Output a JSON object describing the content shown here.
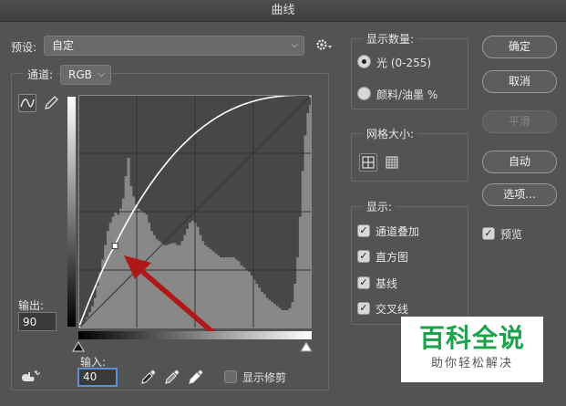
{
  "window": {
    "title": "曲线"
  },
  "preset": {
    "label": "预设:",
    "value": "自定"
  },
  "channel": {
    "label": "通道:",
    "value": "RGB"
  },
  "curve": {
    "points": [
      [
        0,
        0
      ],
      [
        40,
        90
      ],
      [
        255,
        255
      ]
    ],
    "histogram": [
      2,
      4,
      7,
      11,
      16,
      22,
      30,
      42,
      55,
      68,
      82,
      96,
      104,
      110,
      114,
      112,
      118,
      128,
      150,
      168,
      140,
      130,
      122,
      118,
      116,
      114,
      112,
      104,
      96,
      92,
      88,
      86,
      84,
      82,
      82,
      83,
      84,
      84,
      82,
      82,
      86,
      92,
      98,
      104,
      106,
      104,
      100,
      92,
      86,
      82,
      80,
      78,
      76,
      74,
      72,
      70,
      70,
      70,
      70,
      70,
      70,
      68,
      66,
      62,
      60,
      58,
      56,
      52,
      48,
      44,
      40,
      36,
      34,
      30,
      28,
      26,
      24,
      22,
      20,
      18,
      18,
      18,
      20,
      26,
      44,
      70,
      110,
      155,
      190,
      212,
      220
    ],
    "histogram_color": "#888888",
    "curve_color": "#ffffff"
  },
  "output": {
    "label": "输出:",
    "value": "90"
  },
  "input": {
    "label": "输入:",
    "value": "40"
  },
  "show_amount": {
    "title": "显示数量:",
    "light": "光 (0-255)",
    "pigment": "颜料/油墨 %",
    "selected": "light"
  },
  "grid_size": {
    "title": "网格大小:"
  },
  "show": {
    "title": "显示:",
    "channel_overlay": "通道叠加",
    "histogram": "直方图",
    "baseline": "基线",
    "intersection": "交叉线"
  },
  "buttons": {
    "ok": "确定",
    "cancel": "取消",
    "smooth": "平滑",
    "auto": "自动",
    "options": "选项..."
  },
  "preview": {
    "label": "预览",
    "checked": true
  },
  "show_clipping": {
    "label": "显示修剪",
    "checked": false
  },
  "annotation": {
    "arrow_color": "#b01818"
  },
  "watermark": {
    "main": "百科全说",
    "sub": "助你轻松解决",
    "main_color": "#1aa34a"
  },
  "icons": [
    "gear-icon",
    "curve-point-tool-icon",
    "pencil-icon",
    "hand-target-icon",
    "black-eyedropper-icon",
    "gray-eyedropper-icon",
    "white-eyedropper-icon",
    "grid-4-icon",
    "grid-10-icon"
  ]
}
